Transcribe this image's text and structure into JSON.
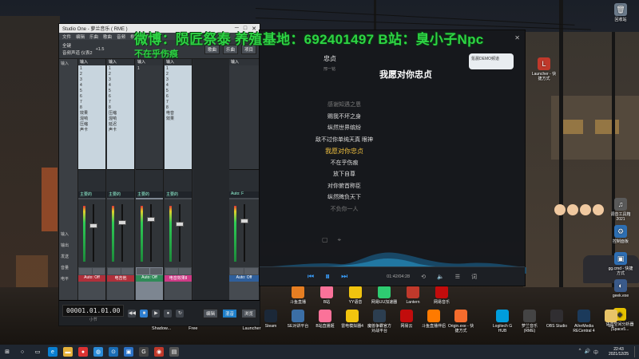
{
  "studio": {
    "title": "Studio One - 萝兰音乐 ( RME )",
    "menu": [
      "文件",
      "编辑",
      "乐曲",
      "歌曲",
      "音频",
      "视图",
      "帮助"
    ],
    "toolbar": {
      "label1": "全键",
      "label2": "音频声道 仪表2",
      "value": "+1.5",
      "btn1": "歌曲",
      "btn2": "乐曲",
      "btn3": "项目"
    },
    "left_labels": [
      "输入",
      "",
      "",
      "",
      "",
      "",
      "",
      "",
      "",
      "",
      "",
      "",
      "",
      "",
      "",
      "",
      "",
      "",
      "",
      "",
      "输入",
      "输出",
      "发送",
      "音量",
      "电平"
    ],
    "channels": [
      {
        "input": "输入",
        "inserts": [
          "1",
          "2",
          "3",
          "4",
          "5",
          "6",
          "7",
          "8",
          "效果",
          "混响",
          "压缩",
          "声卡"
        ],
        "io": "主要的",
        "name": "Auto: Off",
        "color": "r"
      },
      {
        "input": "输入",
        "inserts": [
          "1",
          "2",
          "3",
          "4",
          "5",
          "6",
          "7",
          "8",
          "压缩",
          "混响",
          "延迟",
          "声卡"
        ],
        "io": "主要的",
        "name": "电吉他",
        "color": "r"
      },
      {
        "input": "输入",
        "inserts": [
          "1"
        ],
        "io": "主要的",
        "name": "Auto: Off",
        "color": "g"
      },
      {
        "input": "输入",
        "inserts": [
          "1",
          "2",
          "3",
          "4",
          "5",
          "6",
          "7",
          "8",
          "电音",
          "效果"
        ],
        "io": "主要的",
        "name": "电音效果Ⅱ",
        "color": "p"
      },
      {
        "input": "输入",
        "inserts": [],
        "io": "Auto: F",
        "name": "Auto: Off",
        "color": "b"
      }
    ],
    "timecode": "00001.01.01.00",
    "timecode_sub": "小节",
    "bottom_labels": [
      "Shadow...",
      "Free",
      "Launcher"
    ],
    "bottom_buttons": [
      "编辑",
      "混音",
      "浏览"
    ]
  },
  "player": {
    "song_title": "忠贞",
    "song_sub": "邢一铭",
    "now_line": "我愿对你忠贞",
    "pill_text": "氪晨DEMO频道",
    "lyrics": [
      {
        "text": "感谢知遇之恩",
        "state": "dim"
      },
      {
        "text": "赐我不坏之身",
        "state": "normal"
      },
      {
        "text": "纵然世界缤纷",
        "state": "normal"
      },
      {
        "text": "敌不过你单纯天真 眼神",
        "state": "normal"
      },
      {
        "text": "我愿对你忠贞",
        "state": "active"
      },
      {
        "text": "不在乎伤痕",
        "state": "normal"
      },
      {
        "text": "放下自尊",
        "state": "normal"
      },
      {
        "text": "对你俯首称臣",
        "state": "normal"
      },
      {
        "text": "纵然睥负天下",
        "state": "normal"
      },
      {
        "text": "不负你一人",
        "state": "dim"
      }
    ],
    "time": "01:42/04:28",
    "close": "✕"
  },
  "overlay": {
    "line1": "微博：陨匠祭泰 养殖基地：692401497 B站：臭小子Npc",
    "line2": "不在乎伤痕"
  },
  "desktop_icons": [
    {
      "label": "回收站",
      "glyph": "🗑",
      "color": "#6b7a8a"
    },
    {
      "label": "Launcher - 快捷方式",
      "glyph": "L",
      "color": "#c0392b"
    },
    {
      "label": "控制面板",
      "glyph": "⚙",
      "color": "#2d6fb3"
    },
    {
      "label": "gg.cmd - 快捷方式",
      "glyph": "▣",
      "color": "#2e6fb5"
    },
    {
      "label": "geek.exe",
      "glyph": "◐",
      "color": "#3a5a8a"
    },
    {
      "label": "调音工具箱2021",
      "glyph": "♫",
      "color": "#5a5a5a"
    },
    {
      "label": "语音空间分析器(Space5...",
      "glyph": "◆",
      "color": "#e5c100"
    }
  ],
  "row_icons": [
    {
      "label": "Steam",
      "color": "#1b2838"
    },
    {
      "label": "SE对讲平台",
      "color": "#3b6ea5"
    },
    {
      "label": "B站直播姬",
      "color": "#fb7299"
    },
    {
      "label": "雷电模拟器4",
      "color": "#f1c40f"
    },
    {
      "label": "魔兽争霸官方对战平台",
      "color": "#2c3e50"
    },
    {
      "label": "网易云",
      "color": "#c20c0c"
    },
    {
      "label": "斗鱼直播伴侣",
      "color": "#ff7a00"
    },
    {
      "label": "Origin.exe - 快捷方式",
      "color": "#f56c2d"
    },
    {
      "label": "Logitech G HUB",
      "color": "#009ddc"
    },
    {
      "label": "萝兰音乐(RME)",
      "color": "#444"
    },
    {
      "label": "OBS Studio",
      "color": "#302e31"
    },
    {
      "label": "AVerMedia RECentral 4",
      "color": "#1b3a5b"
    },
    {
      "label": "cfg",
      "color": "#e8c468"
    }
  ],
  "row_icons_top": [
    {
      "label": "斗鱼直播",
      "color": "#e67e22"
    },
    {
      "label": "B站",
      "color": "#fb7299"
    },
    {
      "label": "YY语音",
      "color": "#f1c40f"
    },
    {
      "label": "网易UU加速器",
      "color": "#2ecc71"
    },
    {
      "label": "Lantern",
      "color": "#c0392b"
    },
    {
      "label": "网易音乐",
      "color": "#c20c0c"
    }
  ],
  "taskbar": {
    "time": "22:43",
    "date": "2021/12/25",
    "icons": [
      {
        "name": "windows",
        "glyph": "⊞",
        "color": "#1f2630"
      },
      {
        "name": "search",
        "glyph": "○",
        "color": "#1f2630"
      },
      {
        "name": "task-view",
        "glyph": "▭",
        "color": "#1f2630"
      },
      {
        "name": "edge",
        "glyph": "e",
        "color": "#0a7fd1"
      },
      {
        "name": "explorer",
        "glyph": "▬",
        "color": "#e5b23b"
      },
      {
        "name": "app1",
        "glyph": "●",
        "color": "#d33"
      },
      {
        "name": "app2",
        "glyph": "◍",
        "color": "#2a8bd8"
      },
      {
        "name": "app3",
        "glyph": "⊙",
        "color": "#1a6db5"
      },
      {
        "name": "app4",
        "glyph": "▣",
        "color": "#2b72c7"
      },
      {
        "name": "app5",
        "glyph": "G",
        "color": "#444"
      },
      {
        "name": "app6",
        "glyph": "◉",
        "color": "#c0392b"
      },
      {
        "name": "app7",
        "glyph": "▤",
        "color": "#555"
      }
    ],
    "tray": [
      "^",
      "🔊",
      "中"
    ]
  }
}
